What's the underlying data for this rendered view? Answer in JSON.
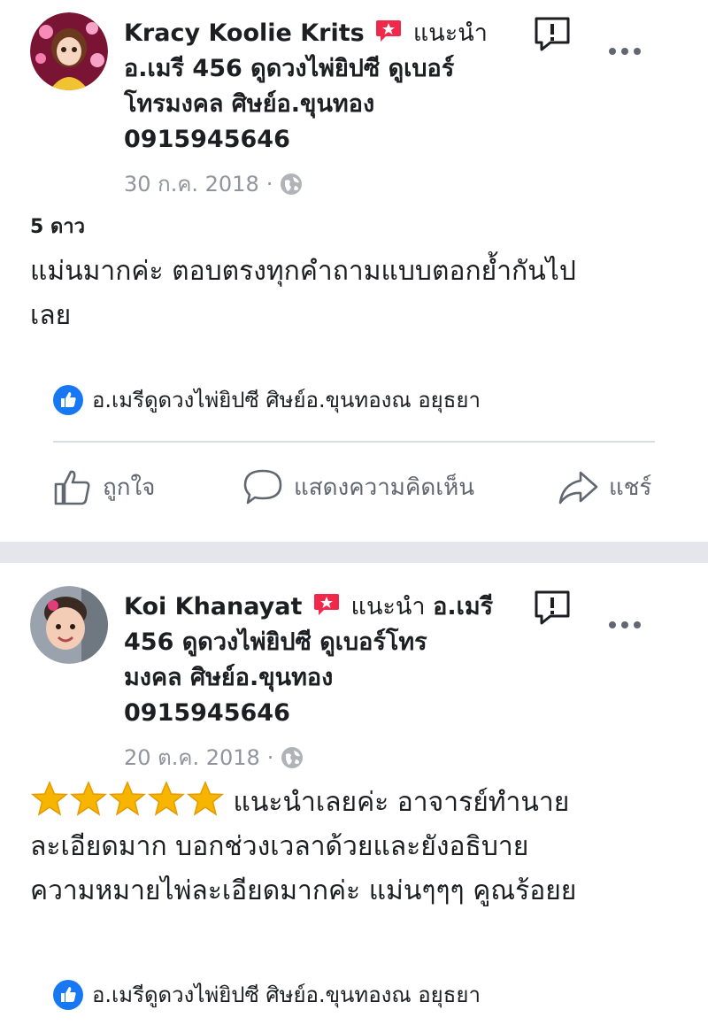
{
  "post1": {
    "author": "Kracy Koolie Krits",
    "recommend_label": "แนะนำ",
    "business_line1": "อ.เมรี 456 ดูดวงไพ่ยิปซี ดูเบอร์",
    "business_line2": "โทรมงคล ศิษย์อ.ขุนทอง",
    "business_line3": "0915945646",
    "date": "30 ก.ค. 2018",
    "dot": "·",
    "rating": "5 ดาว",
    "review_line1": "แม่นมากค่ะ ตอบตรงทุกคำถามแบบตอกย้ำกันไป",
    "review_line2": "เลย",
    "liked_by": "อ.เมรีดูดวงไพ่ยิปซี ศิษย์อ.ขุนทองณ อยุธยา",
    "actions": {
      "like": "ถูกใจ",
      "comment": "แสดงความคิดเห็น",
      "share": "แชร์"
    }
  },
  "post2": {
    "author": "Koi Khanayat",
    "recommend_label": "แนะนำ",
    "business_inline": "อ.เมรี",
    "business_line2": "456 ดูดวงไพ่ยิปซี ดูเบอร์โทร",
    "business_line3": "มงคล ศิษย์อ.ขุนทอง",
    "business_line4": "0915945646",
    "date": "20 ต.ค. 2018",
    "dot": "·",
    "review_line1": "แนะนำเลยค่ะ อาจารย์ทำนาย",
    "review_line2": "ละเอียดมาก บอกช่วงเวลาด้วยและยังอธิบาย",
    "review_line3": "ความหมายไพ่ละเอียดมากค่ะ แม่นๆๆๆ คูณร้อยย",
    "liked_by": "อ.เมรีดูดวงไพ่ยิปซี ศิษย์อ.ขุนทองณ อยุธยา"
  },
  "icons": {
    "recommend": "recommend-star-badge-icon",
    "globe": "globe-icon",
    "report": "report-exclamation-icon",
    "more": "more-options-icon",
    "like_badge": "thumbs-up-badge-icon",
    "like": "thumbs-up-icon",
    "comment": "speech-bubble-icon",
    "share": "share-arrow-icon",
    "star": "star-emoji-icon"
  },
  "colors": {
    "recommend_red": "#f0284a",
    "like_blue": "#1877f2",
    "muted_text": "#90949c",
    "separator": "#e4e6eb",
    "star_gold": "#f7b500"
  }
}
